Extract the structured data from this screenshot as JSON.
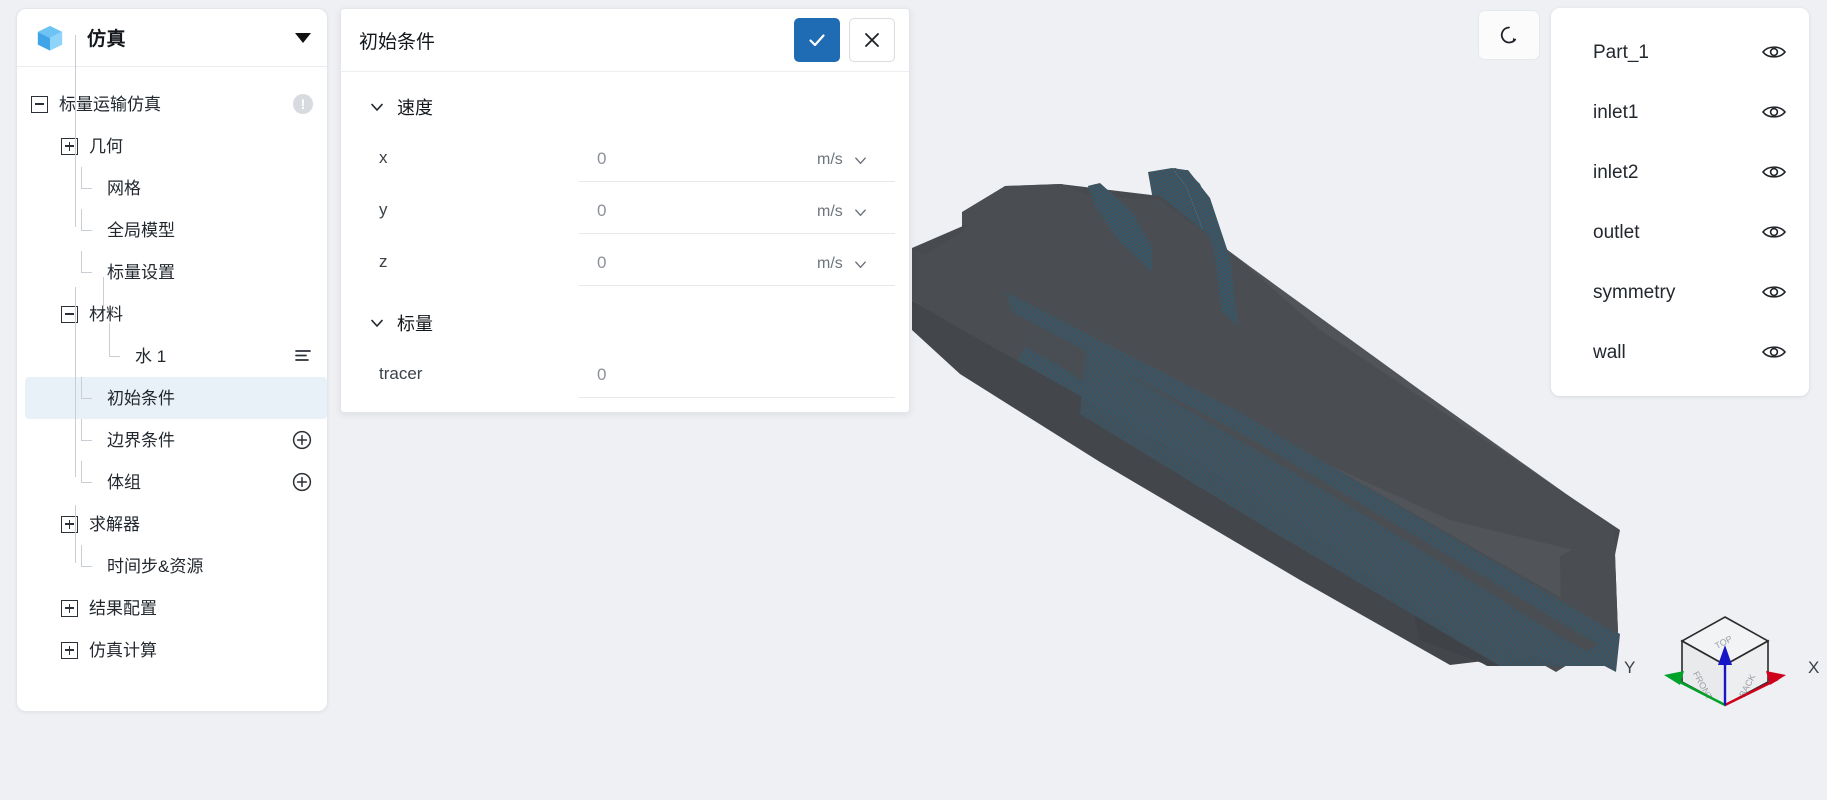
{
  "app": {
    "title": "仿真",
    "logo_icon": "cube-icon",
    "caret_icon": "caret-down-icon"
  },
  "sidebar": {
    "tree": [
      {
        "label": "标量运输仿真",
        "toggle": "minus",
        "depth": 0,
        "badge": "!",
        "badge_icon": "warning-icon"
      },
      {
        "label": "几何",
        "toggle": "plus",
        "depth": 1
      },
      {
        "label": "网格",
        "toggle": "leaf",
        "depth": 2
      },
      {
        "label": "全局模型",
        "toggle": "leaf",
        "depth": 2
      },
      {
        "label": "标量设置",
        "toggle": "leaf",
        "depth": 2
      },
      {
        "label": "材料",
        "toggle": "minus",
        "depth": 1
      },
      {
        "label": "水 1",
        "toggle": "leaf",
        "depth": 3,
        "action_icon": "list-menu-icon"
      },
      {
        "label": "初始条件",
        "toggle": "leaf",
        "depth": 2,
        "selected": true
      },
      {
        "label": "边界条件",
        "toggle": "leaf",
        "depth": 2,
        "action_icon": "plus-circle-icon"
      },
      {
        "label": "体组",
        "toggle": "leaf",
        "depth": 2,
        "action_icon": "plus-circle-icon"
      },
      {
        "label": "求解器",
        "toggle": "plus",
        "depth": 1
      },
      {
        "label": "时间步&资源",
        "toggle": "leaf",
        "depth": 2
      },
      {
        "label": "结果配置",
        "toggle": "plus",
        "depth": 1
      },
      {
        "label": "仿真计算",
        "toggle": "plus",
        "depth": 1
      }
    ]
  },
  "dialog": {
    "title": "初始条件",
    "confirm_label": "✓",
    "confirm_icon": "check-icon",
    "cancel_icon": "close-icon",
    "sections": [
      {
        "title": "速度",
        "chevron_icon": "chevron-down-icon",
        "fields": [
          {
            "name": "x",
            "value": "0",
            "placeholder": "0",
            "unit": "m/s",
            "unit_icon": "chevron-down-icon"
          },
          {
            "name": "y",
            "value": "0",
            "placeholder": "0",
            "unit": "m/s",
            "unit_icon": "chevron-down-icon"
          },
          {
            "name": "z",
            "value": "0",
            "placeholder": "0",
            "unit": "m/s",
            "unit_icon": "chevron-down-icon"
          }
        ]
      },
      {
        "title": "标量",
        "chevron_icon": "chevron-down-icon",
        "fields": [
          {
            "name": "tracer",
            "value": "0",
            "placeholder": "0",
            "unit": "",
            "unit_icon": ""
          }
        ]
      }
    ]
  },
  "parts_panel": {
    "items": [
      {
        "label": "Part_1",
        "visibility_icon": "eye-icon"
      },
      {
        "label": "inlet1",
        "visibility_icon": "eye-icon"
      },
      {
        "label": "inlet2",
        "visibility_icon": "eye-icon"
      },
      {
        "label": "outlet",
        "visibility_icon": "eye-icon"
      },
      {
        "label": "symmetry",
        "visibility_icon": "eye-icon"
      },
      {
        "label": "wall",
        "visibility_icon": "eye-icon"
      }
    ]
  },
  "viewport": {
    "reset_icon": "reset-view-icon",
    "gizmo": {
      "axis_x_label": "X",
      "axis_y_label": "Y",
      "face_top": "TOP",
      "face_front": "FRONT",
      "face_back": "BACK"
    },
    "colors": {
      "background": "#eef0f4",
      "surface": "#4a4e52",
      "mesh_edge": "#2b5c76",
      "axis_x": "#d0021b",
      "axis_y": "#00a229",
      "axis_z": "#1717c8"
    }
  },
  "theme": {
    "accent": "#1f6cb4",
    "selected_row": "#e9f1f8",
    "panel_bg": "#ffffff",
    "page_bg": "#eef0f4"
  }
}
